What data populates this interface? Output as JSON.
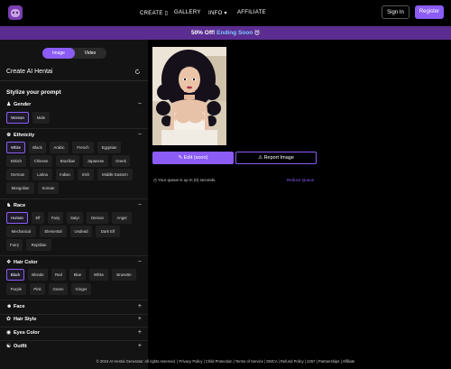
{
  "header": {
    "nav": [
      "CREATE ▯",
      "GALLERY",
      "INFO ▾",
      "AFFILIATE"
    ],
    "signin_label": "Sign In",
    "register_label": "Register"
  },
  "promo": {
    "text": "50% Off!",
    "highlight": "Ending Soon",
    "icon": "alarm-clock-icon"
  },
  "sidebar": {
    "mode_tabs": [
      "Image",
      "Video"
    ],
    "active_mode": "Image",
    "title": "Create AI Hentai",
    "subtitle": "Stylize your prompt",
    "sections": [
      {
        "name": "Gender",
        "icon": "gender-icon",
        "toggle": "−",
        "options": [
          "Woman",
          "Male"
        ],
        "selected": "Woman"
      },
      {
        "name": "Ethnicity",
        "icon": "ethnicity-icon",
        "toggle": "−",
        "options": [
          "White",
          "Black",
          "Arabic",
          "French",
          "Egyptian",
          "British",
          "Chinese",
          "Brazilian",
          "Japanese",
          "Greek",
          "German",
          "Latina",
          "Indian",
          "Irish",
          "Middle Eastern",
          "Mongolian",
          "Korean"
        ],
        "selected": "White"
      },
      {
        "name": "Race",
        "icon": "race-icon",
        "toggle": "−",
        "options": [
          "Human",
          "Elf",
          "Fairy",
          "Satyr",
          "Demon",
          "Angel",
          "Mechanical",
          "Elemental",
          "Undead",
          "Dark Elf",
          "Furry",
          "Reptilian"
        ],
        "selected": "Human"
      },
      {
        "name": "Hair Color",
        "icon": "hair-color-icon",
        "toggle": "−",
        "options": [
          "Black",
          "Blonde",
          "Red",
          "Blue",
          "White",
          "Brunette",
          "Purple",
          "Pink",
          "Green",
          "Ginger"
        ],
        "selected": "Black"
      },
      {
        "name": "Face",
        "icon": "face-icon",
        "toggle": "+",
        "options": []
      },
      {
        "name": "Hair Style",
        "icon": "hair-style-icon",
        "toggle": "+",
        "options": []
      },
      {
        "name": "Eyes Color",
        "icon": "eyes-color-icon",
        "toggle": "+",
        "options": []
      },
      {
        "name": "Outfit",
        "icon": "outfit-icon",
        "toggle": "+",
        "options": []
      }
    ]
  },
  "main": {
    "edit_label": "Edit (soon)",
    "report_label": "Report Image",
    "queue_text": "Your queue is up in (0) seconds.",
    "reduce_label": "Reduce Queue"
  },
  "footer": {
    "text": "© 2024 AI Hentai Generator. All rights reserved. | Privacy Policy | Child Protection | Terms of Service | DMCA | Refund Policy | 2257 | Partnerships | Affiliate"
  },
  "colors": {
    "accent": "#8b5cf6",
    "promo_bg": "#5b2d91",
    "sidebar_bg": "#131313",
    "background": "#000000"
  }
}
